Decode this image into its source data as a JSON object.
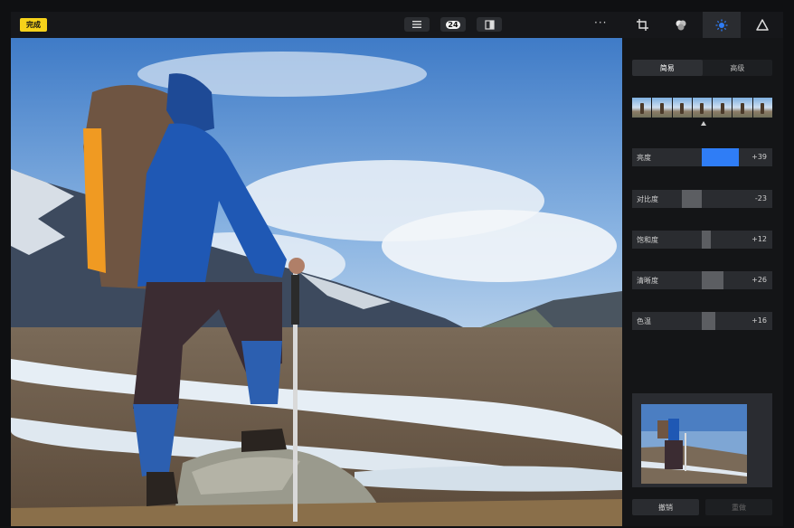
{
  "toolbar": {
    "done_label": "完成",
    "badge_number": "24",
    "more_label": "···",
    "tools": [
      "crop-icon",
      "filters-icon",
      "adjust-icon",
      "tone-icon"
    ],
    "active_tool": "adjust-icon"
  },
  "panel": {
    "tabs": [
      "简易",
      "高级"
    ],
    "active_tab": "简易",
    "sliders": [
      {
        "label": "亮度",
        "value": "+39",
        "level": 0.39,
        "active": true
      },
      {
        "label": "对比度",
        "value": "-23",
        "level": -0.23,
        "active": false
      },
      {
        "label": "饱和度",
        "value": "+12",
        "level": 0.12,
        "active": false
      },
      {
        "label": "清晰度",
        "value": "+26",
        "level": 0.26,
        "active": false
      },
      {
        "label": "色温",
        "value": "+16",
        "level": 0.16,
        "active": false
      }
    ],
    "undo_label": "撤销",
    "redo_label": "重做"
  },
  "colors": {
    "accent_yellow": "#f6d21a",
    "accent_blue": "#2f7df6",
    "panel_bg": "#141517"
  }
}
